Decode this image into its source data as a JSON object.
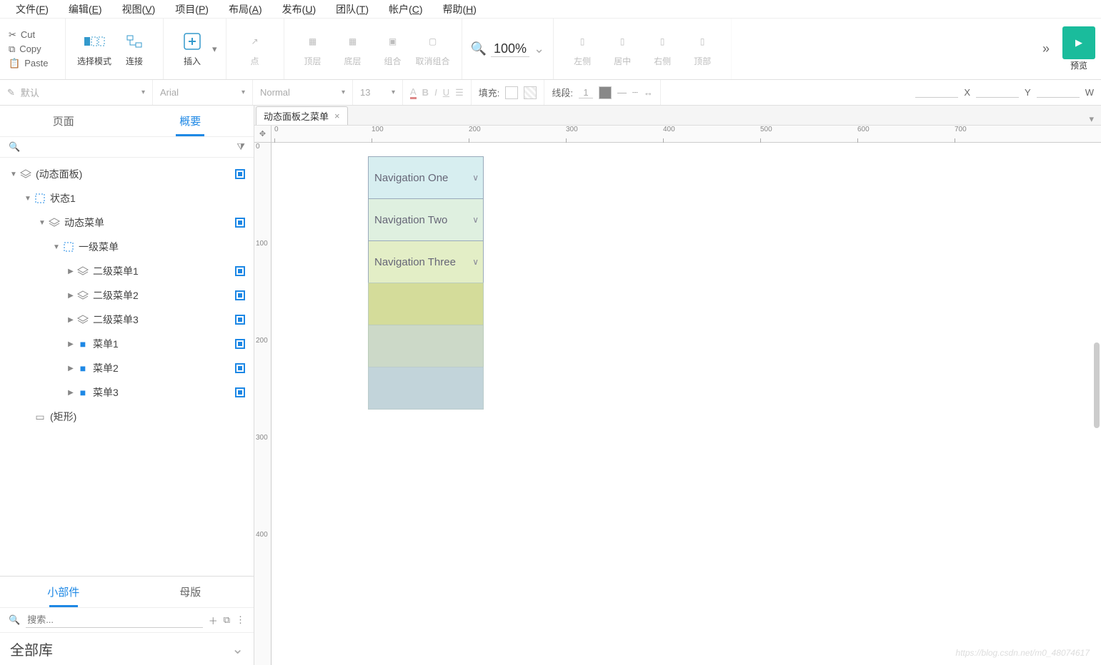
{
  "menubar": [
    {
      "label": "文件",
      "key": "F"
    },
    {
      "label": "编辑",
      "key": "E"
    },
    {
      "label": "视图",
      "key": "V"
    },
    {
      "label": "项目",
      "key": "P"
    },
    {
      "label": "布局",
      "key": "A"
    },
    {
      "label": "发布",
      "key": "U"
    },
    {
      "label": "团队",
      "key": "T"
    },
    {
      "label": "帐户",
      "key": "C"
    },
    {
      "label": "帮助",
      "key": "H"
    }
  ],
  "clipboard": {
    "cut": "Cut",
    "copy": "Copy",
    "paste": "Paste"
  },
  "toolbar1": {
    "select_mode": "选择模式",
    "connect": "连接",
    "insert": "插入",
    "point": "点",
    "top_layer": "顶层",
    "bottom_layer": "底层",
    "group": "组合",
    "ungroup": "取消组合",
    "zoom": "100%",
    "align_left": "左侧",
    "align_center": "居中",
    "align_right": "右侧",
    "align_top": "顶部",
    "more": "»",
    "preview": "预览"
  },
  "toolbar2": {
    "style": "默认",
    "font": "Arial",
    "weight": "Normal",
    "size": "13",
    "fill_label": "填充:",
    "line_label": "线段:",
    "line_width": "1",
    "pos_x_label": "X",
    "pos_y_label": "Y",
    "pos_w_label": "W"
  },
  "left_panel": {
    "tab_page": "页面",
    "tab_outline": "概要",
    "outline": [
      {
        "indent": 0,
        "caret": "▼",
        "ico": "layers",
        "label": "(动态面板)",
        "chk": true
      },
      {
        "indent": 1,
        "caret": "▼",
        "ico": "state",
        "label": "状态1",
        "chk": false
      },
      {
        "indent": 2,
        "caret": "▼",
        "ico": "layers",
        "label": "动态菜单",
        "chk": true
      },
      {
        "indent": 3,
        "caret": "▼",
        "ico": "state",
        "label": "一级菜单",
        "chk": false
      },
      {
        "indent": 4,
        "caret": "▶",
        "ico": "layers",
        "label": "二级菜单1",
        "chk": true
      },
      {
        "indent": 4,
        "caret": "▶",
        "ico": "layers",
        "label": "二级菜单2",
        "chk": true
      },
      {
        "indent": 4,
        "caret": "▶",
        "ico": "layers",
        "label": "二级菜单3",
        "chk": true
      },
      {
        "indent": 4,
        "caret": "▶",
        "ico": "folder",
        "label": "菜单1",
        "chk": true
      },
      {
        "indent": 4,
        "caret": "▶",
        "ico": "folder",
        "label": "菜单2",
        "chk": true
      },
      {
        "indent": 4,
        "caret": "▶",
        "ico": "folder",
        "label": "菜单3",
        "chk": true
      },
      {
        "indent": 1,
        "caret": "",
        "ico": "rect",
        "label": "(矩形)",
        "chk": false
      }
    ],
    "tab_widgets": "小部件",
    "tab_masters": "母版",
    "search_placeholder": "搜索...",
    "lib_title": "全部库"
  },
  "canvas": {
    "doc_tab": "动态面板之菜单",
    "h_ticks": [
      0,
      100,
      200,
      300,
      400,
      500,
      600,
      700
    ],
    "v_ticks": [
      0,
      100,
      200,
      300,
      400
    ],
    "nav_items": [
      {
        "label": "Navigation One",
        "cls": "r1",
        "chev": true
      },
      {
        "label": "Navigation Two",
        "cls": "r2",
        "chev": true
      },
      {
        "label": "Navigation Three",
        "cls": "r3",
        "chev": true
      },
      {
        "label": "",
        "cls": "r4",
        "chev": false
      },
      {
        "label": "",
        "cls": "r5",
        "chev": false
      },
      {
        "label": "",
        "cls": "r6",
        "chev": false
      }
    ],
    "watermark": "https://blog.csdn.net/m0_48074617"
  }
}
